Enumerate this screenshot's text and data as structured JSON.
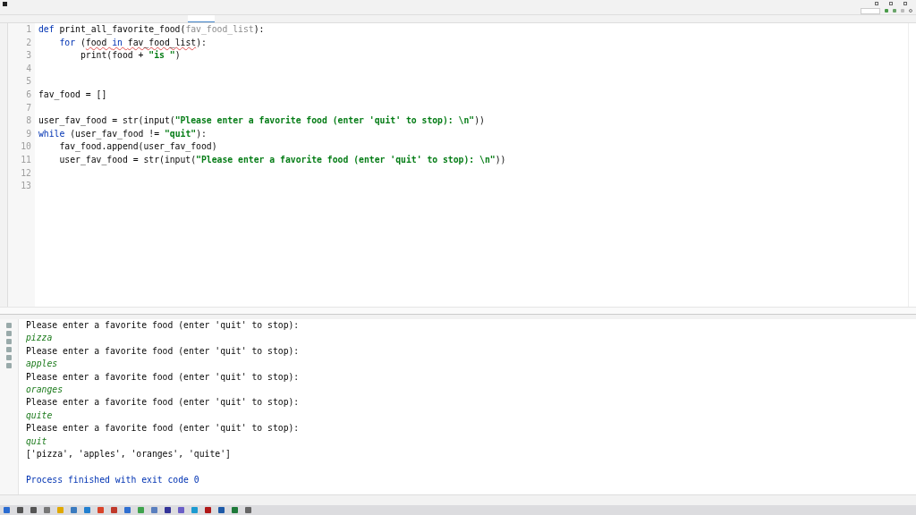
{
  "editor": {
    "lines": [
      {
        "number": "1",
        "tokens": [
          {
            "text": "def ",
            "kind": "kw"
          },
          {
            "text": "print_all_favorite_food(",
            "kind": "plain"
          },
          {
            "text": "fav_food_list",
            "kind": "param"
          },
          {
            "text": "):",
            "kind": "plain"
          }
        ]
      },
      {
        "number": "2",
        "tokens": [
          {
            "text": "    for ",
            "kind": "kw"
          },
          {
            "text": "(",
            "kind": "plain"
          },
          {
            "text": "food ",
            "kind": "plain",
            "squiggle": true
          },
          {
            "text": "in ",
            "kind": "kw",
            "squiggle": true
          },
          {
            "text": "fav_food_list",
            "kind": "plain",
            "squiggle": true
          },
          {
            "text": "):",
            "kind": "plain"
          }
        ]
      },
      {
        "number": "3",
        "tokens": [
          {
            "text": "        print(food + ",
            "kind": "plain"
          },
          {
            "text": "\"is \"",
            "kind": "str"
          },
          {
            "text": ")",
            "kind": "plain"
          }
        ]
      },
      {
        "number": "4"
      },
      {
        "number": "5"
      },
      {
        "number": "6",
        "tokens": [
          {
            "text": "fav_food = []",
            "kind": "plain"
          }
        ]
      },
      {
        "number": "7"
      },
      {
        "number": "8",
        "tokens": [
          {
            "text": "user_fav_food = str(input(",
            "kind": "plain"
          },
          {
            "text": "\"Please enter a favorite food (enter 'quit' to stop): \\n\"",
            "kind": "str"
          },
          {
            "text": "))",
            "kind": "plain"
          }
        ]
      },
      {
        "number": "9",
        "tokens": [
          {
            "text": "while ",
            "kind": "kw"
          },
          {
            "text": "(user_fav_food != ",
            "kind": "plain"
          },
          {
            "text": "\"quit\"",
            "kind": "str"
          },
          {
            "text": "):",
            "kind": "plain"
          }
        ]
      },
      {
        "number": "10",
        "tokens": [
          {
            "text": "    fav_food.append(user_fav_food)",
            "kind": "plain"
          }
        ]
      },
      {
        "number": "11",
        "tokens": [
          {
            "text": "    user_fav_food = str(input(",
            "kind": "plain"
          },
          {
            "text": "\"Please enter a favorite food (enter 'quit' to stop): \\n\"",
            "kind": "str"
          },
          {
            "text": "))",
            "kind": "plain"
          }
        ]
      },
      {
        "number": "12"
      },
      {
        "number": "13"
      }
    ]
  },
  "run_panel": {
    "output": [
      {
        "text": "Please enter a favorite food (enter 'quit' to stop):",
        "kind": "prompt"
      },
      {
        "text": "pizza",
        "kind": "input"
      },
      {
        "text": "Please enter a favorite food (enter 'quit' to stop):",
        "kind": "prompt"
      },
      {
        "text": "apples",
        "kind": "input"
      },
      {
        "text": "Please enter a favorite food (enter 'quit' to stop):",
        "kind": "prompt"
      },
      {
        "text": "oranges",
        "kind": "input"
      },
      {
        "text": "Please enter a favorite food (enter 'quit' to stop):",
        "kind": "prompt"
      },
      {
        "text": "quite",
        "kind": "input"
      },
      {
        "text": "Please enter a favorite food (enter 'quit' to stop):",
        "kind": "prompt"
      },
      {
        "text": "quit",
        "kind": "input"
      },
      {
        "text": "['pizza', 'apples', 'oranges', 'quite']",
        "kind": "prompt"
      },
      {
        "kind": "blank"
      },
      {
        "text": "Process finished with exit code 0",
        "kind": "exit"
      }
    ]
  }
}
